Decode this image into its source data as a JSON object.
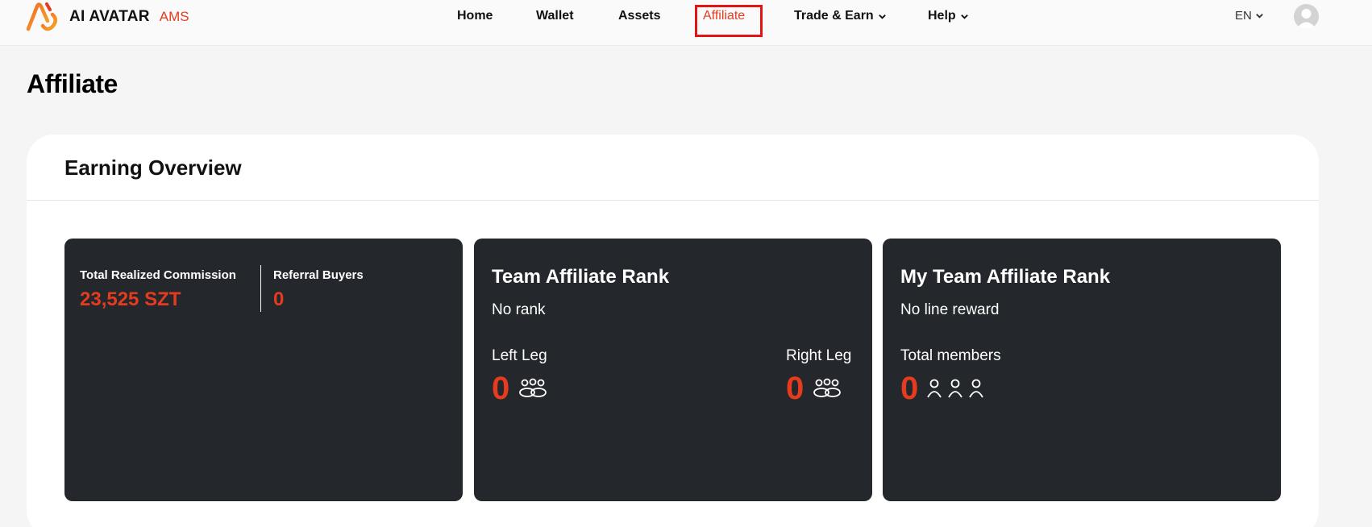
{
  "brand": {
    "name": "AI AVATAR",
    "suffix": "AMS"
  },
  "nav": [
    {
      "label": "Home",
      "active": false
    },
    {
      "label": "Wallet",
      "active": false
    },
    {
      "label": "Assets",
      "active": false
    },
    {
      "label": "Affiliate",
      "active": true
    },
    {
      "label": "Trade & Earn",
      "dropdown": true
    },
    {
      "label": "Help",
      "dropdown": true
    }
  ],
  "language": "EN",
  "page": {
    "title": "Affiliate"
  },
  "overview": {
    "title": "Earning Overview",
    "commission": {
      "label": "Total Realized Commission",
      "value": "23,525 SZT"
    },
    "buyers": {
      "label": "Referral Buyers",
      "value": "0"
    },
    "team_rank": {
      "title": "Team Affiliate Rank",
      "status": "No rank",
      "left_label": "Left Leg",
      "left_value": "0",
      "right_label": "Right Leg",
      "right_value": "0"
    },
    "my_rank": {
      "title": "My Team Affiliate Rank",
      "status": "No line reward",
      "members_label": "Total members",
      "members_value": "0"
    }
  },
  "icons": {
    "logo": "brand-logo-icon",
    "chevron": "chevron-down-icon",
    "avatar": "user-avatar-icon",
    "team": "team-group-icon",
    "members": "members-icon"
  },
  "colors": {
    "accent": "#e53b1e",
    "card_bg": "#24272b",
    "highlight_box": "#e31414"
  }
}
